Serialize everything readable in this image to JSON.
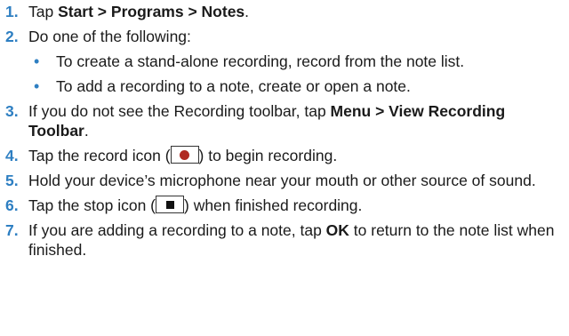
{
  "steps": [
    {
      "num": "1.",
      "pre": "Tap ",
      "bold": "Start > Programs > Notes",
      "post": "."
    },
    {
      "num": "2.",
      "text": "Do one of the following:",
      "bullet": "•",
      "bullets": [
        "To create a stand-alone recording, record from the note list.",
        "To add a recording to a note, create or open a note."
      ]
    },
    {
      "num": "3.",
      "pre": "If you do not see the Recording toolbar, tap ",
      "bold": "Menu > View Recording Toolbar",
      "post": "."
    },
    {
      "num": "4.",
      "pre": "Tap the record icon (",
      "icon": "record-icon",
      "post": ") to begin recording."
    },
    {
      "num": "5.",
      "text": "Hold your device’s microphone near your mouth or other source of sound."
    },
    {
      "num": "6.",
      "pre": "Tap the stop icon (",
      "icon": "stop-icon",
      "post": ") when finished recording."
    },
    {
      "num": "7.",
      "pre": "If you are adding a recording to a note, tap ",
      "bold": "OK",
      "post": " to return to the note list when finished."
    }
  ],
  "colors": {
    "number": "#2e7fc2",
    "bullet": "#2e7fc2",
    "text": "#1a1a1a",
    "record_dot": "#b02a22"
  }
}
